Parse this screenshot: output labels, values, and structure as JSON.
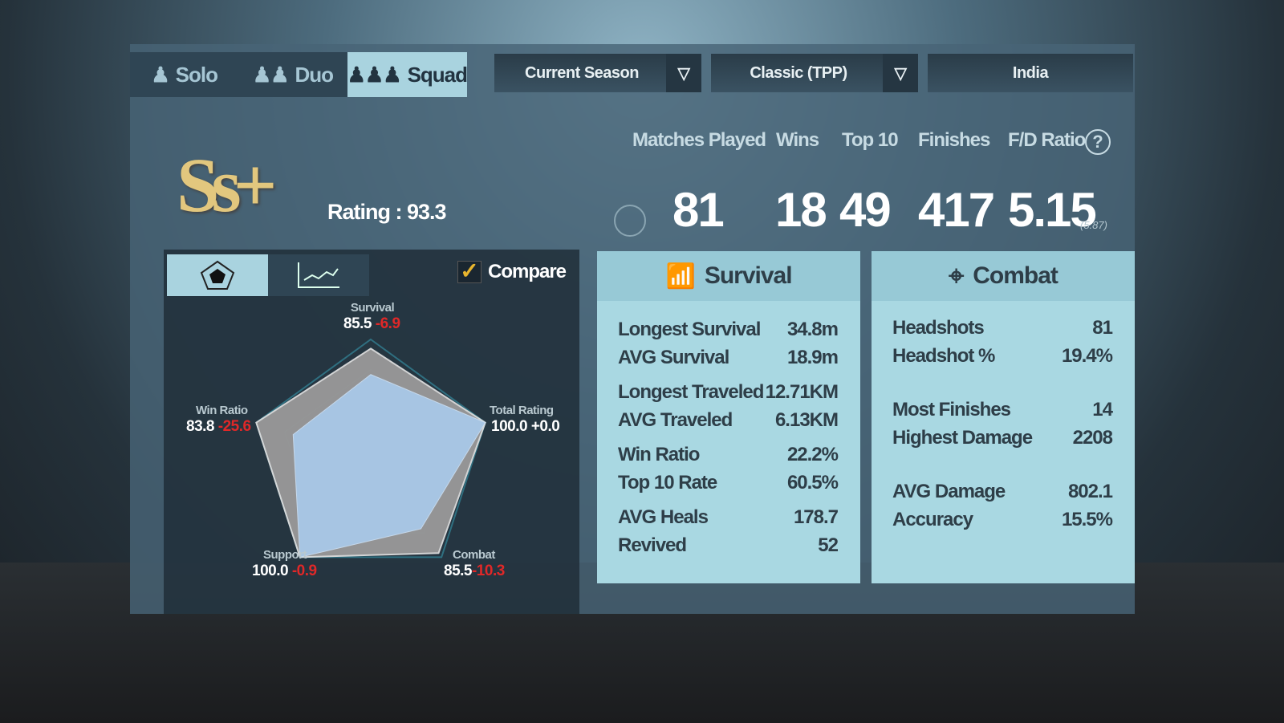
{
  "modes": [
    {
      "label": "Solo",
      "icon": "solo-person-icon"
    },
    {
      "label": "Duo",
      "icon": "duo-people-icon"
    },
    {
      "label": "Squad",
      "icon": "squad-people-icon",
      "active": true
    }
  ],
  "filters": {
    "season": "Current Season",
    "mode": "Classic (TPP)",
    "region": "India"
  },
  "tier": {
    "badge": "Ss+",
    "rating_label": "Rating",
    "rating": "93.3"
  },
  "summary": {
    "headers": [
      "Matches Played",
      "Wins",
      "Top 10",
      "Finishes",
      "F/D Ratio"
    ],
    "values": [
      "81",
      "18",
      "49",
      "417",
      "5.15"
    ],
    "fd_sub": "(5.87)"
  },
  "radar": {
    "compare_label": "Compare",
    "compare_checked": true,
    "axes": [
      {
        "name": "Survival",
        "value": "85.5",
        "delta": "-6.9"
      },
      {
        "name": "Total Rating",
        "value": "100.0",
        "delta": "+0.0"
      },
      {
        "name": "Combat",
        "value": "85.5",
        "delta": "-10.3"
      },
      {
        "name": "Support",
        "value": "100.0",
        "delta": "-0.9"
      },
      {
        "name": "Win Ratio",
        "value": "83.8",
        "delta": "-25.6"
      }
    ],
    "colors": {
      "player": "#a9c8e8",
      "compare": "#9a9a9a"
    }
  },
  "survival": {
    "title": "Survival",
    "rows": [
      [
        "Longest Survival",
        "34.8m"
      ],
      [
        "AVG Survival",
        "18.9m"
      ],
      [
        "Longest Traveled",
        "12.71KM"
      ],
      [
        "AVG Traveled",
        "6.13KM"
      ],
      [
        "Win Ratio",
        "22.2%"
      ],
      [
        "Top 10 Rate",
        "60.5%"
      ],
      [
        "AVG Heals",
        "178.7"
      ],
      [
        "Revived",
        "52"
      ]
    ]
  },
  "combat": {
    "title": "Combat",
    "rows": [
      [
        "Headshots",
        "81"
      ],
      [
        "Headshot %",
        "19.4%"
      ],
      [
        "Most Finishes",
        "14"
      ],
      [
        "Highest Damage",
        "2208"
      ],
      [
        "AVG Damage",
        "802.1"
      ],
      [
        "Accuracy",
        "15.5%"
      ]
    ]
  }
}
